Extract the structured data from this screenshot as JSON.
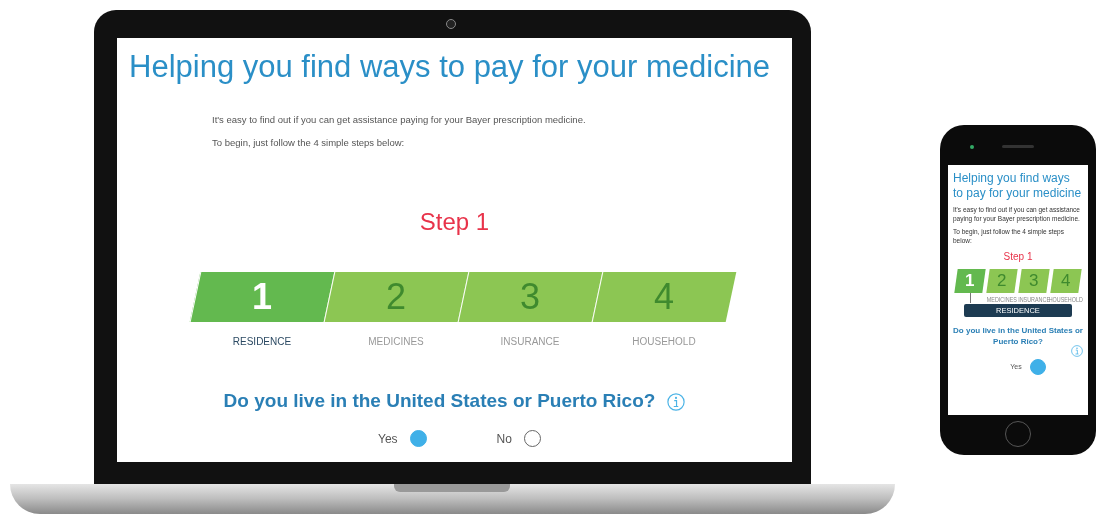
{
  "laptop_screen": {
    "title": "Helping you find ways to pay for your medicine",
    "intro": [
      "It's easy to find out if you can get assistance paying for your Bayer prescription medicine.",
      "To begin, just follow the 4 simple steps below:"
    ],
    "step_heading": "Step 1",
    "steps": [
      {
        "number": "1",
        "label": "RESIDENCE",
        "selected": true
      },
      {
        "number": "2",
        "label": "MEDICINES",
        "selected": false
      },
      {
        "number": "3",
        "label": "INSURANCE",
        "selected": false
      },
      {
        "number": "4",
        "label": "HOUSEHOLD",
        "selected": false
      }
    ],
    "question": "Do you live in the United States or Puerto Rico?",
    "options": [
      {
        "label": "Yes",
        "selected": true
      },
      {
        "label": "No",
        "selected": false
      }
    ]
  },
  "phone_screen": {
    "title": "Helping you find ways to pay for your medicine",
    "intro": [
      "It's easy to find out if you can get assistance paying for your Bayer prescription medicine.",
      "To begin, just follow the 4 simple steps below:"
    ],
    "step_heading": "Step 1",
    "steps": [
      {
        "number": "1",
        "selected": true
      },
      {
        "number": "2",
        "label": "MEDICINES",
        "selected": false
      },
      {
        "number": "3",
        "label": "INSURANCE",
        "selected": false
      },
      {
        "number": "4",
        "label": "HOUSEHOLD",
        "selected": false
      }
    ],
    "current_step_label": "RESIDENCE",
    "question": "Do you live in the United States or Puerto Rico?",
    "options": [
      {
        "label": "Yes",
        "selected": true
      }
    ]
  }
}
